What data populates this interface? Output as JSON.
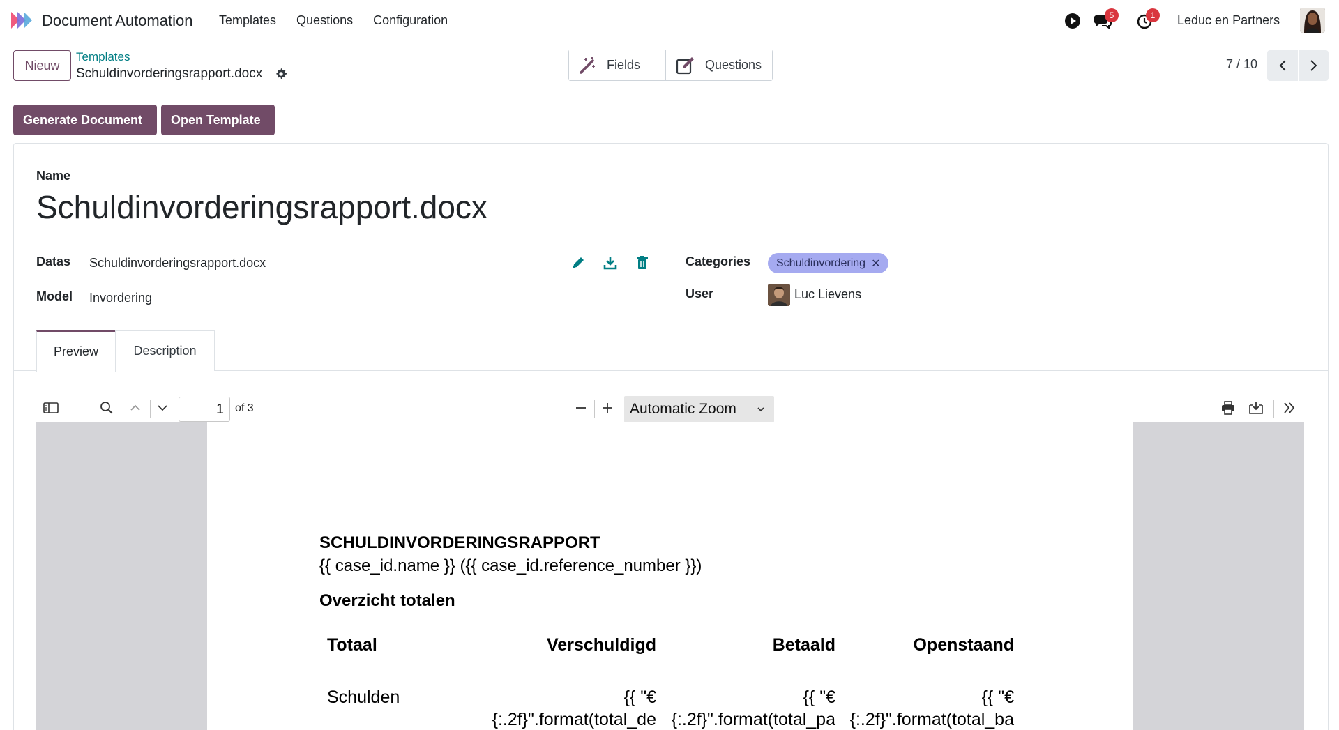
{
  "navbar": {
    "app_name": "Document Automation",
    "menu": [
      "Templates",
      "Questions",
      "Configuration"
    ],
    "messages_badge": "5",
    "activity_badge": "1",
    "company": "Leduc en Partners"
  },
  "control": {
    "new_label": "Nieuw",
    "breadcrumb_parent": "Templates",
    "breadcrumb_current": "Schuldinvorderingsrapport.docx",
    "smart_buttons": [
      "Fields",
      "Questions"
    ],
    "pager": "7 / 10"
  },
  "actions": {
    "generate": "Generate Document",
    "open_template": "Open Template"
  },
  "form": {
    "name_label": "Name",
    "name_value": "Schuldinvorderingsrapport.docx",
    "datas_label": "Datas",
    "datas_value": "Schuldinvorderingsrapport.docx",
    "model_label": "Model",
    "model_value": "Invordering",
    "categories_label": "Categories",
    "category_tag": "Schuldinvordering",
    "user_label": "User",
    "user_value": "Luc Lievens"
  },
  "tabs": [
    "Preview",
    "Description"
  ],
  "pdf": {
    "page": "1",
    "of_pages": "of 3",
    "zoom": "Automatic Zoom"
  },
  "document": {
    "heading": "SCHULDINVORDERINGSRAPPORT",
    "subheading": "{{ case_id.name }} ({{ case_id.reference_number }})",
    "section": "Overzicht totalen",
    "table_headers": [
      "Totaal",
      "Verschuldigd",
      "Betaald",
      "Openstaand"
    ],
    "row_label": "Schulden",
    "row_cells": [
      [
        "{{ \"€",
        "{:.2f}\".format(total_de"
      ],
      [
        "{{ \"€",
        "{:.2f}\".format(total_pa"
      ],
      [
        "{{ \"€",
        "{:.2f}\".format(total_ba"
      ]
    ]
  },
  "colors": {
    "brand": "#714b67",
    "link": "#017e84",
    "tag": "#a5aaf0",
    "badge": "#d9363e"
  }
}
